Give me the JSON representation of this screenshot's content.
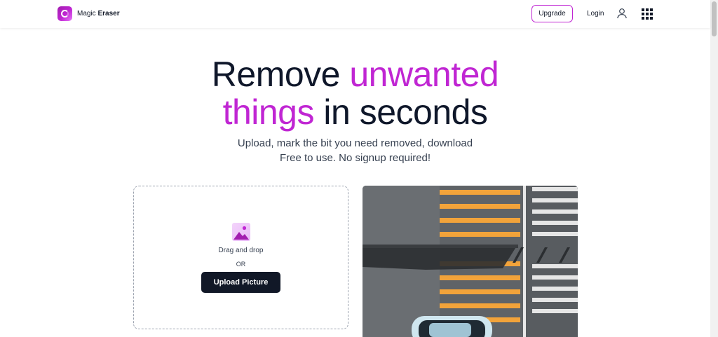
{
  "header": {
    "logo": {
      "name_light": "Magic",
      "name_bold": "Eraser"
    },
    "upgrade_label": "Upgrade",
    "login_label": "Login"
  },
  "hero": {
    "title_part1": "Remove ",
    "title_accent1": "unwanted",
    "title_accent2": "things",
    "title_part2": " in seconds",
    "subtitle_line1": "Upload, mark the bit you need removed, download",
    "subtitle_line2": "Free to use. No signup required!"
  },
  "upload": {
    "drag_text": "Drag and drop",
    "or_text": "OR",
    "button_label": "Upload Picture"
  },
  "colors": {
    "accent": "#c026d3",
    "dark": "#111827",
    "crosswalk_orange": "#f2a33a"
  },
  "icons": [
    "logo-icon",
    "user-icon",
    "apps-grid-icon",
    "image-icon"
  ]
}
